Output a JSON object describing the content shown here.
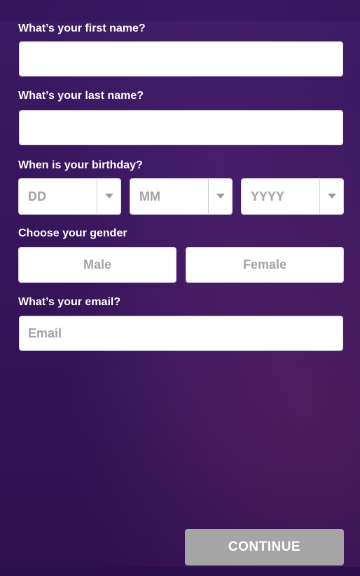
{
  "form": {
    "first_name": {
      "label": "What’s your first name?",
      "value": "",
      "placeholder": ""
    },
    "last_name": {
      "label": "What’s your last name?",
      "value": "",
      "placeholder": ""
    },
    "birthday": {
      "label": "When is your birthday?",
      "day": "DD",
      "month": "MM",
      "year": "YYYY"
    },
    "gender": {
      "label": "Choose your gender",
      "options": [
        "Male",
        "Female"
      ]
    },
    "email": {
      "label": "What’s your email?",
      "value": "",
      "placeholder": "Email"
    },
    "continue_label": "CONTINUE"
  },
  "colors": {
    "background": "#3a1860",
    "field_bg": "#ffffff",
    "placeholder": "#a3a3a3",
    "continue_button_disabled": "#a5a5a5"
  },
  "icons": {
    "select_caret": "chevron-down-icon"
  }
}
